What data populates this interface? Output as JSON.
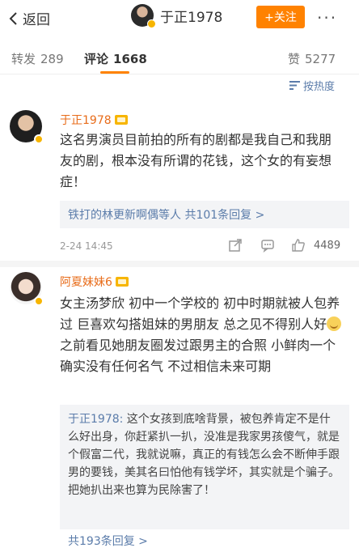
{
  "topbar": {
    "back_label": "返回",
    "profile_name": "于正1978",
    "follow_label": "+关注",
    "more_label": "···"
  },
  "tabs": [
    {
      "label": "转发",
      "count": "289"
    },
    {
      "label": "评论",
      "count": "1668"
    },
    {
      "label": "赞",
      "count": "5277"
    }
  ],
  "sort": {
    "label": "按热度"
  },
  "comments": [
    {
      "user": "于正1978",
      "text": "这名男演员目前拍的所有的剧都是我自己和我朋友的剧，根本没有所谓的花钱，这个女的有妄想症！",
      "replies_link": "铁打的林更新啊偶等人 共101条回复 >",
      "time": "2-24 14:45",
      "likes": "4489"
    },
    {
      "user": "阿夏妹妹6",
      "text_before_emoji": "女主汤梦欣  初中一个学校的  初中时期就被人包养过  巨喜欢勾搭姐妹的男朋友  总之见不得别人好",
      "text_after_emoji": " 之前看见她朋友圈发过跟男主的合照  小鲜肉一个  确实没有任何名气  不过相信未来可期",
      "reply": {
        "name": "于正1978:",
        "text": " 这个女孩到底啥背景，被包养肯定不是什么好出身，你赶紧扒一扒，没准是我家男孩傻气，就是个假富二代，我就说嘛，真正的有钱怎么会不断伸手跟男的要钱，美其名曰怕他有钱学坏，其实就是个骗子。把她扒出来也算为民除害了！"
      },
      "more_replies": "共193条回复 >"
    }
  ]
}
